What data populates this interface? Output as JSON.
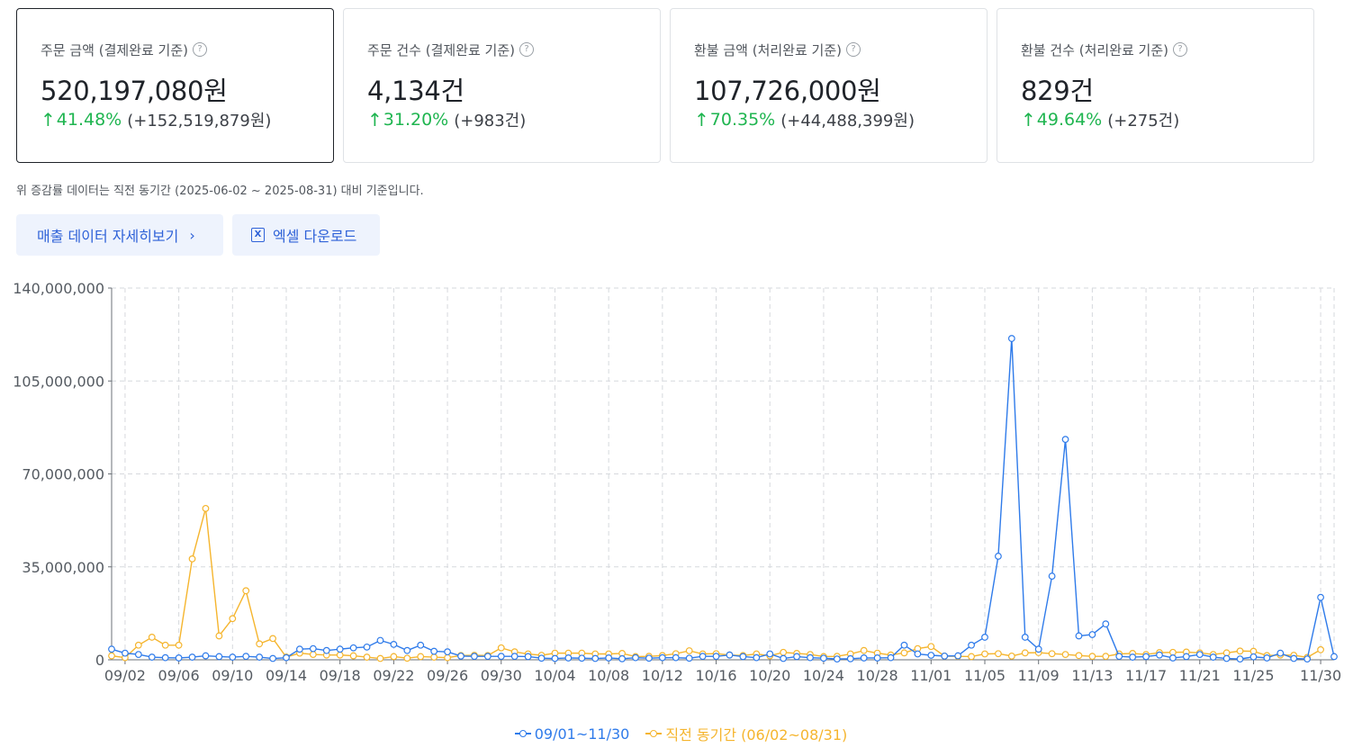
{
  "cards": [
    {
      "title": "주문 금액 (결제완료 기준)",
      "value": "520,197,080원",
      "pct": "41.48%",
      "diff": "(+152,519,879원)",
      "active": true
    },
    {
      "title": "주문 건수 (결제완료 기준)",
      "value": "4,134건",
      "pct": "31.20%",
      "diff": "(+983건)",
      "active": false
    },
    {
      "title": "환불 금액 (처리완료 기준)",
      "value": "107,726,000원",
      "pct": "70.35%",
      "diff": "(+44,488,399원)",
      "active": false
    },
    {
      "title": "환불 건수 (처리완료 기준)",
      "value": "829건",
      "pct": "49.64%",
      "diff": "(+275건)",
      "active": false
    }
  ],
  "help_icon": "?",
  "arrow_icon": "↑",
  "note": "위 증감률 데이터는 직전 동기간 (2025-06-02 ~ 2025-08-31) 대비 기준입니다.",
  "buttons": {
    "detail_label": "매출 데이터 자세히보기",
    "chevron_icon": "›",
    "excel_icon": "X",
    "excel_label": "엑셀 다운로드"
  },
  "colors": {
    "current": "#2f7bea",
    "previous": "#f5b52e",
    "positive": "#1fb550",
    "accent": "#2f62d8"
  },
  "chart_data": {
    "type": "line",
    "ylim": [
      0,
      140000000
    ],
    "yticks": [
      0,
      35000000,
      70000000,
      105000000,
      140000000
    ],
    "ytick_labels": [
      "0",
      "35,000,000",
      "70,000,000",
      "105,000,000",
      "140,000,000"
    ],
    "xtick_labels": [
      "09/02",
      "09/06",
      "09/10",
      "09/14",
      "09/18",
      "09/22",
      "09/26",
      "09/30",
      "10/04",
      "10/08",
      "10/12",
      "10/16",
      "10/20",
      "10/24",
      "10/28",
      "11/01",
      "11/05",
      "11/09",
      "11/13",
      "11/17",
      "11/21",
      "11/25",
      "11/30"
    ],
    "xtick_day_index": [
      1,
      5,
      9,
      13,
      17,
      21,
      25,
      29,
      33,
      37,
      41,
      45,
      49,
      53,
      57,
      61,
      65,
      69,
      73,
      77,
      81,
      85,
      90
    ],
    "grid": true,
    "legend_position": "bottom",
    "series": [
      {
        "name": "09/01~11/30",
        "color": "#2f7bea",
        "values": [
          4000000,
          2500000,
          2000000,
          1000000,
          800000,
          700000,
          1000000,
          1500000,
          1200000,
          1000000,
          1300000,
          1000000,
          500000,
          800000,
          4000000,
          4200000,
          3500000,
          4000000,
          4500000,
          4800000,
          7300000,
          5800000,
          3500000,
          5500000,
          3200000,
          3000000,
          1400000,
          1300000,
          1300000,
          1300000,
          1300000,
          1200000,
          600000,
          500000,
          700000,
          600000,
          500000,
          700000,
          400000,
          800000,
          600000,
          800000,
          800000,
          600000,
          1300000,
          1300000,
          1800000,
          1200000,
          800000,
          2200000,
          500000,
          1200000,
          800000,
          600000,
          300000,
          400000,
          700000,
          700000,
          800000,
          5500000,
          2200000,
          1700000,
          1400000,
          1500000,
          5500000,
          8500000,
          39000000,
          121000000,
          8500000,
          4000000,
          31500000,
          83000000,
          9000000,
          9500000,
          13500000,
          1300000,
          1000000,
          1200000,
          1800000,
          700000,
          1200000,
          2000000,
          1000000,
          500000,
          300000,
          1100000,
          700000,
          2500000,
          500000,
          300000,
          23500000,
          1200000
        ]
      },
      {
        "name": "직전 동기간 (06/02~08/31)",
        "color": "#f5b52e",
        "values": [
          1500000,
          800000,
          5500000,
          8500000,
          5500000,
          5500000,
          38000000,
          57000000,
          9000000,
          15500000,
          26000000,
          6000000,
          8000000,
          1000000,
          2500000,
          2000000,
          1800000,
          1800000,
          1500000,
          1000000,
          500000,
          1200000,
          600000,
          1200000,
          1000000,
          800000,
          1600000,
          1700000,
          1600000,
          4500000,
          3000000,
          2200000,
          1700000,
          2500000,
          2500000,
          2500000,
          2200000,
          2200000,
          2400000,
          1200000,
          1300000,
          1600000,
          2300000,
          3400000,
          2200000,
          2300000,
          1800000,
          1600000,
          2200000,
          1500000,
          2800000,
          2400000,
          2000000,
          1200000,
          1300000,
          2200000,
          3500000,
          2500000,
          1800000,
          2600000,
          4200000,
          5000000,
          1400000,
          1300000,
          1200000,
          2200000,
          2300000,
          1400000,
          2600000,
          2700000,
          2300000,
          2000000,
          1600000,
          1300000,
          1300000,
          2200000,
          2400000,
          2000000,
          2700000,
          2800000,
          2900000,
          2600000,
          2000000,
          2600000,
          3300000,
          3200000,
          1600000,
          1800000,
          1700000,
          900000,
          3800000
        ]
      }
    ]
  }
}
